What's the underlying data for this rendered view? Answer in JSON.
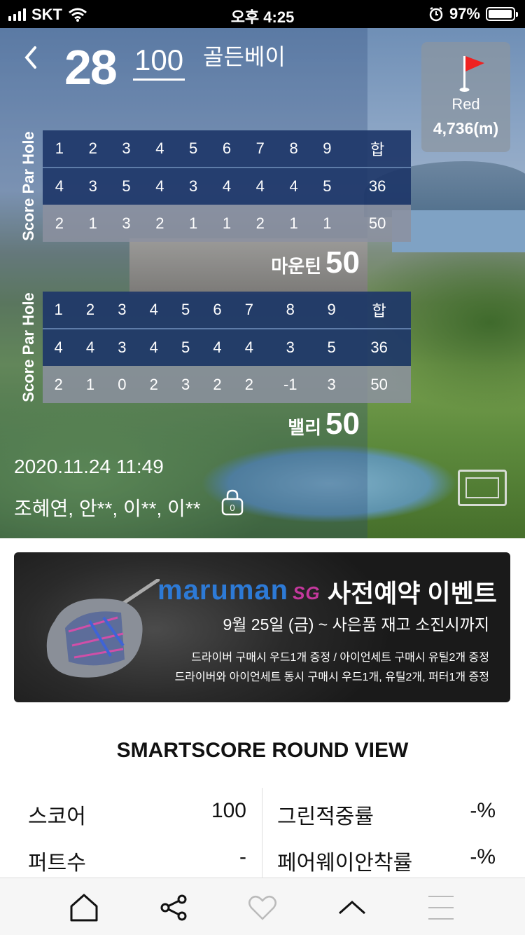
{
  "status": {
    "carrier": "SKT",
    "time": "오후 4:25",
    "battery": "97%",
    "battery_level": 0.97
  },
  "round": {
    "score": "28",
    "total": "100",
    "course": "골든베이",
    "tee": {
      "name": "Red",
      "distance": "4,736(m)"
    },
    "card_side_label": "Score Par Hole",
    "courses": [
      {
        "name": "마운틴",
        "subtotal": "50",
        "holes": [
          "1",
          "2",
          "3",
          "4",
          "5",
          "6",
          "7",
          "8",
          "9",
          "합"
        ],
        "par": [
          "4",
          "3",
          "5",
          "4",
          "3",
          "4",
          "4",
          "4",
          "5",
          "36"
        ],
        "score": [
          "2",
          "1",
          "3",
          "2",
          "1",
          "1",
          "2",
          "1",
          "1",
          "50"
        ]
      },
      {
        "name": "밸리",
        "subtotal": "50",
        "holes": [
          "1",
          "2",
          "3",
          "4",
          "5",
          "6",
          "7",
          "8",
          "9",
          "합"
        ],
        "par": [
          "4",
          "4",
          "3",
          "4",
          "5",
          "4",
          "4",
          "3",
          "5",
          "36"
        ],
        "score": [
          "2",
          "1",
          "0",
          "2",
          "3",
          "2",
          "2",
          "-1",
          "3",
          "50"
        ]
      }
    ],
    "datetime": "2020.11.24 11:49",
    "players": "조혜연, 안**, 이**, 이**",
    "lock_count": "0"
  },
  "banner": {
    "brand": "maruman",
    "brand_sub": "SG",
    "title": "사전예약 이벤트",
    "subtitle": "9월 25일 (금) ~ 사은품 재고 소진시까지",
    "line1": "드라이버 구매시 우드1개 증정  /  아이언세트 구매시 유틸2개 증정",
    "line2": "드라이버와 아이언세트 동시 구매시 우드1개, 유틸2개, 퍼터1개 증정"
  },
  "smartscore": {
    "title": "SMARTSCORE ROUND VIEW",
    "left": [
      {
        "label": "스코어",
        "value": "100"
      },
      {
        "label": "퍼트수",
        "value": "-"
      }
    ],
    "right": [
      {
        "label": "그린적중률",
        "value": "-%"
      },
      {
        "label": "페어웨이안착률",
        "value": "-%"
      }
    ]
  },
  "toolbar": {
    "icons": [
      "home-icon",
      "share-icon",
      "heart-icon",
      "chevron-up-icon",
      "menu-icon"
    ]
  }
}
